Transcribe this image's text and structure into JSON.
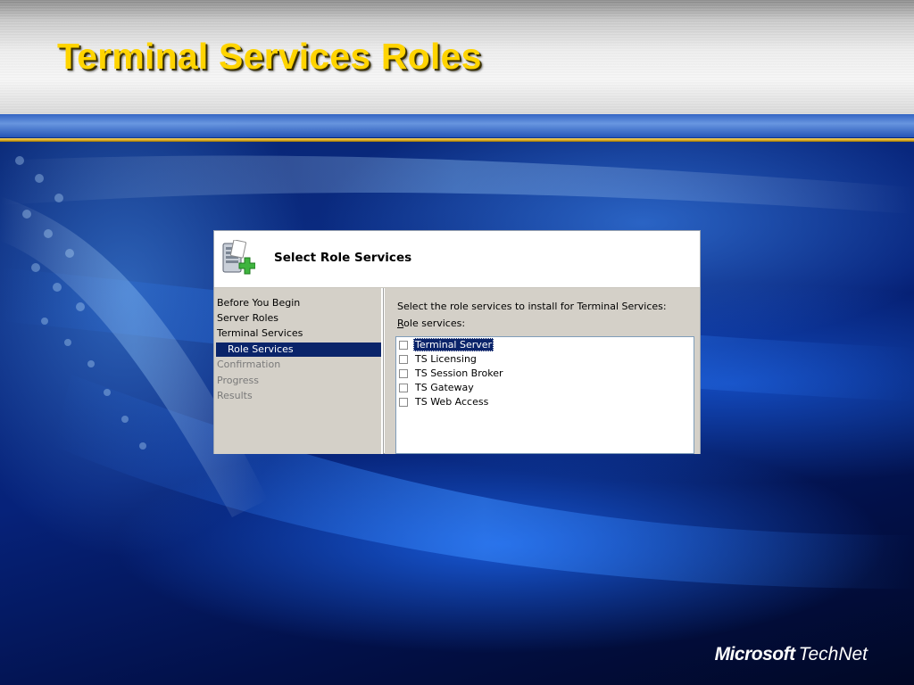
{
  "slide": {
    "title": "Terminal Services Roles",
    "title_color": "#ffd400",
    "accent_rule_color": "#d9a81d"
  },
  "dialog": {
    "title": "Select Role Services",
    "icon": "server-add-icon",
    "nav": {
      "items": [
        {
          "label": "Before You Begin",
          "state": "done"
        },
        {
          "label": "Server Roles",
          "state": "done"
        },
        {
          "label": "Terminal Services",
          "state": "done"
        },
        {
          "label": "Role Services",
          "state": "selected"
        },
        {
          "label": "Confirmation",
          "state": "pending"
        },
        {
          "label": "Progress",
          "state": "pending"
        },
        {
          "label": "Results",
          "state": "pending"
        }
      ],
      "selected_color": "#0a246a"
    },
    "instruction": "Select the role services to install for Terminal Services:",
    "list_label_mnemonic": "R",
    "list_label_rest": "ole services:",
    "role_services": [
      {
        "label": "Terminal Server",
        "checked": false,
        "highlighted": true
      },
      {
        "label": "TS Licensing",
        "checked": false,
        "highlighted": false
      },
      {
        "label": "TS Session Broker",
        "checked": false,
        "highlighted": false
      },
      {
        "label": "TS Gateway",
        "checked": false,
        "highlighted": false
      },
      {
        "label": "TS Web Access",
        "checked": false,
        "highlighted": false
      }
    ]
  },
  "brand": {
    "microsoft": "Microsoft",
    "technet": "TechNet"
  }
}
